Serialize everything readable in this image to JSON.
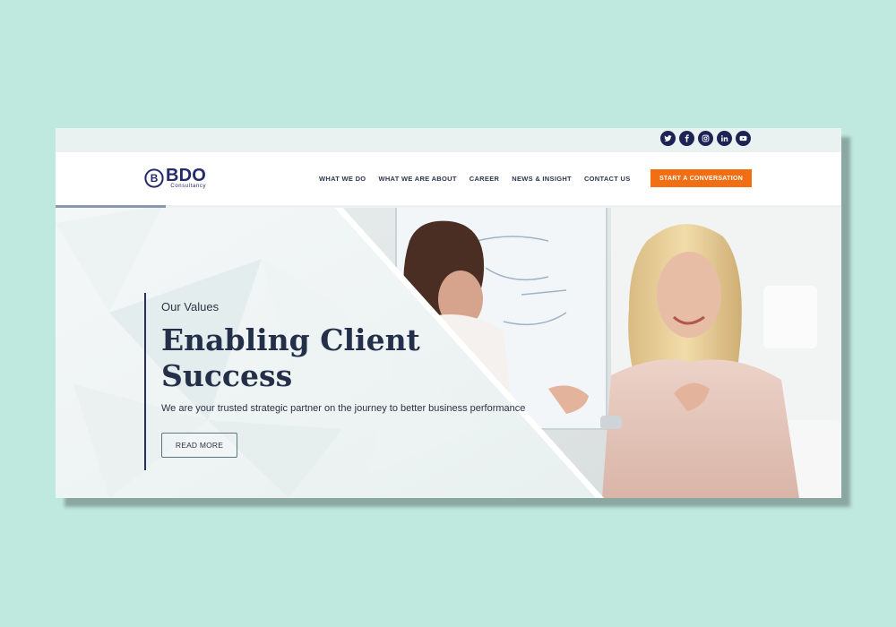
{
  "brand": {
    "mark": "B",
    "name": "BDO",
    "sub": "Consultancy"
  },
  "social": [
    {
      "icon": "twitter-icon"
    },
    {
      "icon": "facebook-icon"
    },
    {
      "icon": "instagram-icon"
    },
    {
      "icon": "linkedin-icon"
    },
    {
      "icon": "youtube-icon"
    }
  ],
  "nav": {
    "items": [
      {
        "label": "WHAT WE DO"
      },
      {
        "label": "WHAT WE ARE ABOUT"
      },
      {
        "label": "CAREER"
      },
      {
        "label": "NEWS & INSIGHT"
      },
      {
        "label": "CONTACT US"
      }
    ],
    "cta": "START A CONVERSATION"
  },
  "hero": {
    "eyebrow": "Our Values",
    "headline": "Enabling Client Success",
    "subtitle": "We are your trusted strategic partner on the journey to better business performance",
    "button": "READ MORE",
    "slider_progress": 0.14
  },
  "colors": {
    "background": "#bfe8df",
    "brand_navy": "#252a6b",
    "cta_orange": "#f26e13",
    "heading": "#24304a"
  }
}
